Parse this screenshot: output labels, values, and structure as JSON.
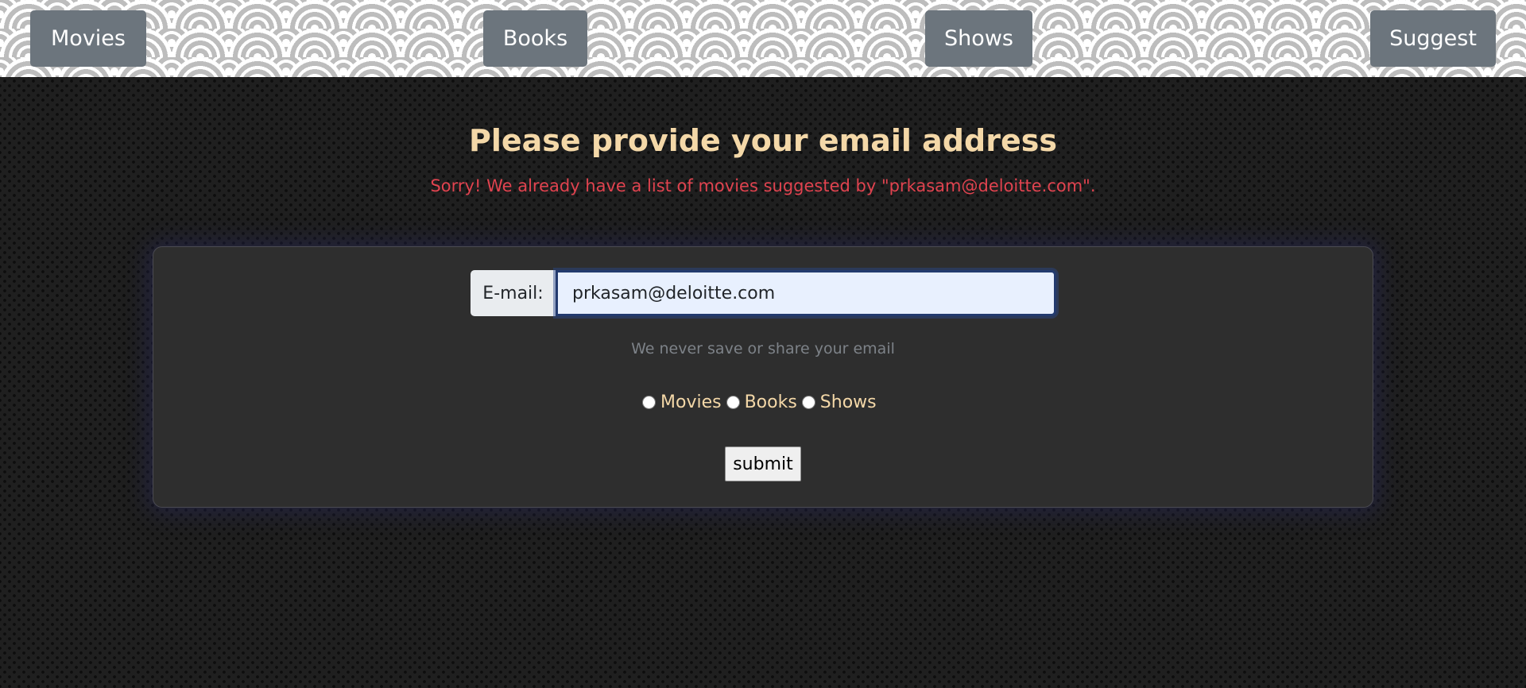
{
  "nav": {
    "movies_label": "Movies",
    "books_label": "Books",
    "shows_label": "Shows",
    "suggest_label": "Suggest"
  },
  "page": {
    "title": "Please provide your email address",
    "error_message": "Sorry! We already have a list of movies suggested by \"prkasam@deloitte.com\"."
  },
  "form": {
    "email_label": "E-mail:",
    "email_value": "prkasam@deloitte.com",
    "help_text": "We never save or share your email",
    "options": [
      {
        "label": "Movies",
        "checked": false
      },
      {
        "label": "Books",
        "checked": false
      },
      {
        "label": "Shows",
        "checked": false
      }
    ],
    "submit_label": "submit"
  },
  "colors": {
    "nav_button_bg": "#6c757d",
    "title_color": "#f4d8a8",
    "error_color": "#e0434f",
    "help_text_color": "#7d8288"
  }
}
